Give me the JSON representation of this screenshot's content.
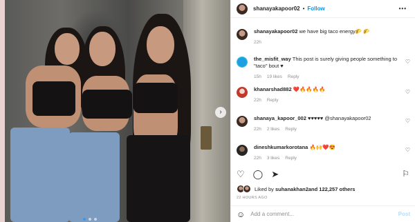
{
  "post": {
    "username": "shanayakapoor02",
    "separator": "•",
    "follow_label": "Follow",
    "more_label": "•••",
    "caption_user": "shanayakapoor02",
    "caption_text": "we have big taco energy🌮 🌮",
    "caption_time": "22h",
    "next_label": "›"
  },
  "comments": [
    {
      "user": "the_misfit_way",
      "text": "This post is surely giving people something to \"taco\" bout ♥",
      "time": "15h",
      "likes": "19 likes",
      "reply": "Reply"
    },
    {
      "user": "khanarshad882",
      "text": "❤️🔥🔥🔥🔥",
      "time": "22h",
      "likes": "",
      "reply": "Reply"
    },
    {
      "user": "shanaya_kapoor_002",
      "text": "♥♥♥♥♥ @shanayakapoor02",
      "time": "22h",
      "likes": "2 likes",
      "reply": "Reply"
    },
    {
      "user": "dineshkumarkorotana",
      "text": "🔥🙌❤️😍",
      "time": "22h",
      "likes": "3 likes",
      "reply": "Reply"
    }
  ],
  "likes_line": {
    "prefix": "Liked by ",
    "user": "suhanakhan2",
    "suffix": " and 122,257 others"
  },
  "date": "22 HOURS AGO",
  "add_comment": {
    "placeholder": "Add a comment...",
    "post_label": "Post"
  },
  "colors": {
    "link": "#0095f6",
    "meta": "#8e8e8e",
    "post_disabled": "#b2dffc"
  }
}
